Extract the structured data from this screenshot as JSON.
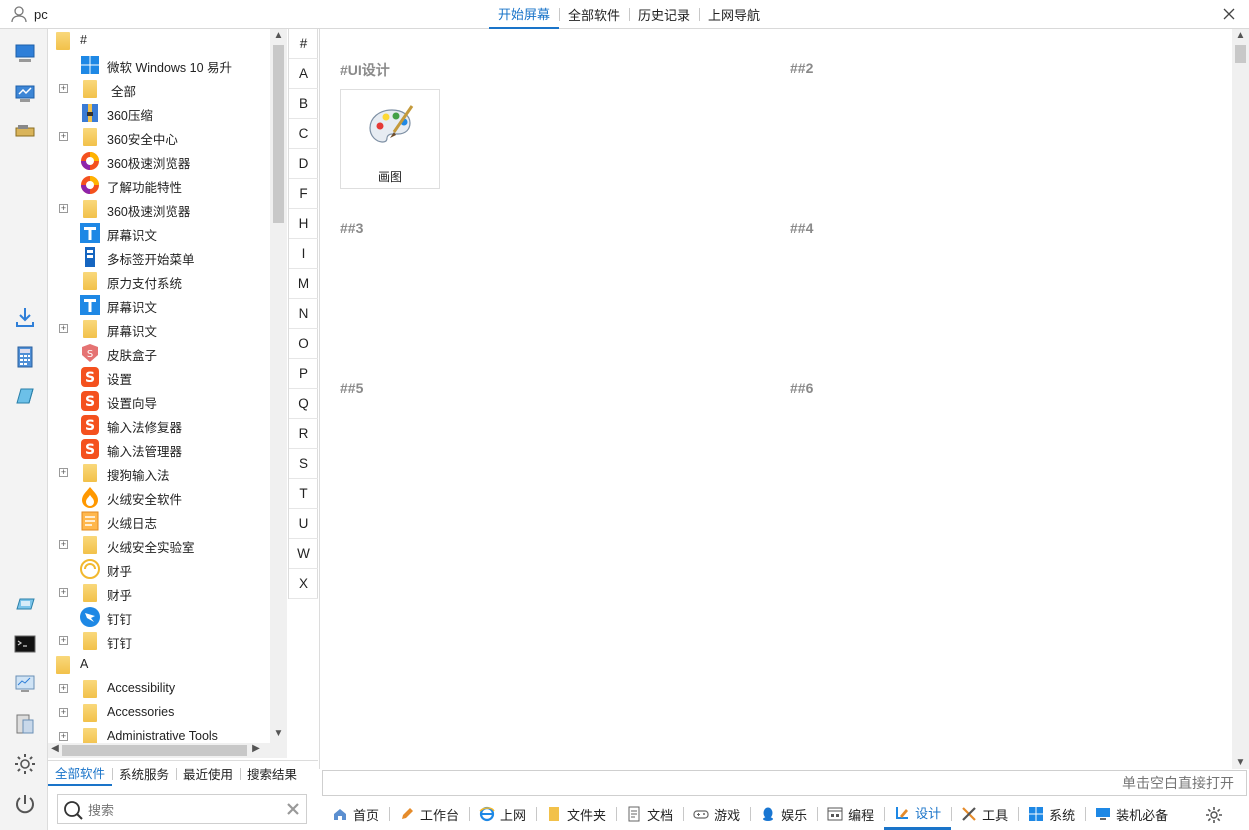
{
  "user": {
    "name": "pc"
  },
  "top_tabs": [
    {
      "label": "开始屏幕",
      "active": true
    },
    {
      "label": "全部软件",
      "active": false
    },
    {
      "label": "历史记录",
      "active": false
    },
    {
      "label": "上网导航",
      "active": false
    }
  ],
  "tree": [
    {
      "label": "#",
      "kind": "group",
      "icon": "folder-icon"
    },
    {
      "label": "微软 Windows 10 易升",
      "kind": "app",
      "icon": "windows-logo-icon"
    },
    {
      "label": "全部",
      "kind": "folder",
      "icon": "folder-icon"
    },
    {
      "label": "360压缩",
      "kind": "app",
      "icon": "archive-icon"
    },
    {
      "label": "360安全中心",
      "kind": "folder",
      "icon": "folder-icon"
    },
    {
      "label": "360极速浏览器",
      "kind": "app",
      "icon": "browser-icon"
    },
    {
      "label": "了解功能特性",
      "kind": "app",
      "icon": "browser-icon"
    },
    {
      "label": "360极速浏览器",
      "kind": "folder",
      "icon": "folder-icon"
    },
    {
      "label": "屏幕识文",
      "kind": "app",
      "icon": "ocr-icon"
    },
    {
      "label": "多标签开始菜单",
      "kind": "app",
      "icon": "start-menu-icon"
    },
    {
      "label": "原力支付系统",
      "kind": "folder-leaf",
      "icon": "folder-icon"
    },
    {
      "label": "屏幕识文",
      "kind": "app",
      "icon": "ocr-icon"
    },
    {
      "label": "屏幕识文",
      "kind": "folder",
      "icon": "folder-icon"
    },
    {
      "label": "皮肤盒子",
      "kind": "app",
      "icon": "skin-box-icon"
    },
    {
      "label": "设置",
      "kind": "app",
      "icon": "sogou-icon"
    },
    {
      "label": "设置向导",
      "kind": "app",
      "icon": "sogou-icon"
    },
    {
      "label": "输入法修复器",
      "kind": "app",
      "icon": "sogou-icon"
    },
    {
      "label": "输入法管理器",
      "kind": "app",
      "icon": "sogou-icon"
    },
    {
      "label": "搜狗输入法",
      "kind": "folder",
      "icon": "folder-icon"
    },
    {
      "label": "火绒安全软件",
      "kind": "app",
      "icon": "huorong-icon"
    },
    {
      "label": "火绒日志",
      "kind": "app",
      "icon": "log-icon"
    },
    {
      "label": "火绒安全实验室",
      "kind": "folder",
      "icon": "folder-icon"
    },
    {
      "label": "财乎",
      "kind": "app",
      "icon": "caihu-icon"
    },
    {
      "label": "财乎",
      "kind": "folder",
      "icon": "folder-icon"
    },
    {
      "label": "钉钉",
      "kind": "app",
      "icon": "dingtalk-icon"
    },
    {
      "label": "钉钉",
      "kind": "folder",
      "icon": "folder-icon"
    },
    {
      "label": "A",
      "kind": "group",
      "icon": "folder-icon"
    },
    {
      "label": "Accessibility",
      "kind": "folder",
      "icon": "folder-icon"
    },
    {
      "label": "Accessories",
      "kind": "folder",
      "icon": "folder-icon"
    },
    {
      "label": "Administrative Tools",
      "kind": "folder",
      "icon": "folder-icon"
    }
  ],
  "left_tabs": [
    {
      "label": "全部软件",
      "active": true
    },
    {
      "label": "系统服务",
      "active": false
    },
    {
      "label": "最近使用",
      "active": false
    },
    {
      "label": "搜索结果",
      "active": false
    }
  ],
  "search": {
    "placeholder": "搜索"
  },
  "alphabet": [
    "#",
    "A",
    "B",
    "C",
    "D",
    "F",
    "H",
    "I",
    "M",
    "N",
    "O",
    "P",
    "Q",
    "R",
    "S",
    "T",
    "U",
    "W",
    "X"
  ],
  "groups": [
    {
      "title": "#UI设计"
    },
    {
      "title": "##2"
    },
    {
      "title": "##3"
    },
    {
      "title": "##4"
    },
    {
      "title": "##5"
    },
    {
      "title": "##6"
    }
  ],
  "tile": {
    "label": "画图",
    "icon": "paint-palette-icon"
  },
  "runbar": {
    "placeholder": "单击空白直接打开"
  },
  "categories": [
    {
      "label": "首页",
      "icon": "home-icon",
      "active": false
    },
    {
      "label": "工作台",
      "icon": "pen-icon",
      "active": false
    },
    {
      "label": "上网",
      "icon": "ie-icon",
      "active": false
    },
    {
      "label": "文件夹",
      "icon": "folder-icon",
      "active": false
    },
    {
      "label": "文档",
      "icon": "document-icon",
      "active": false
    },
    {
      "label": "游戏",
      "icon": "gamepad-icon",
      "active": false
    },
    {
      "label": "娱乐",
      "icon": "qq-icon",
      "active": false
    },
    {
      "label": "编程",
      "icon": "code-icon",
      "active": false
    },
    {
      "label": "设计",
      "icon": "design-icon",
      "active": true
    },
    {
      "label": "工具",
      "icon": "tools-icon",
      "active": false
    },
    {
      "label": "系统",
      "icon": "windows-logo-icon",
      "active": false
    },
    {
      "label": "装机必备",
      "icon": "monitor-icon",
      "active": false
    }
  ],
  "colors": {
    "accent": "#1a74c9",
    "folder": "#f2c14a",
    "group_title": "#8a8a8a"
  }
}
